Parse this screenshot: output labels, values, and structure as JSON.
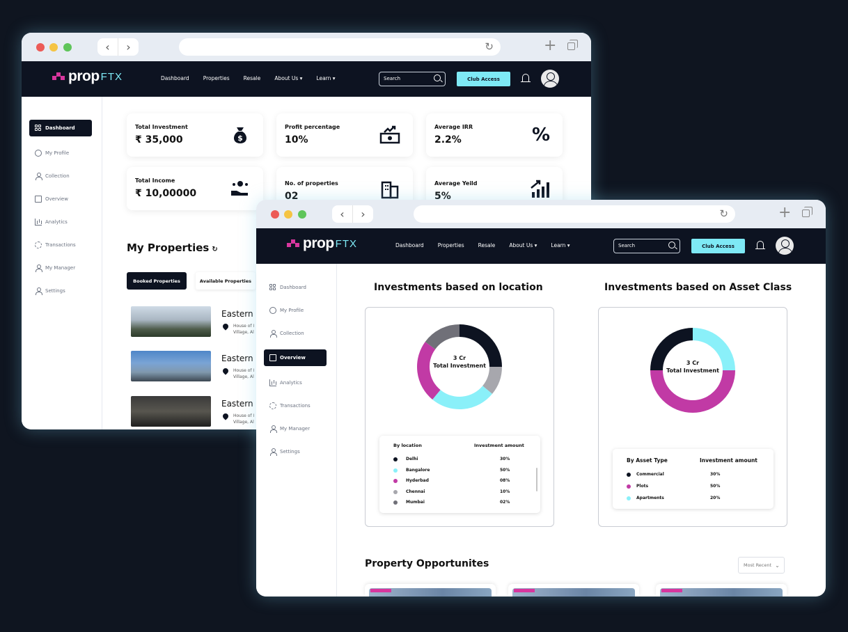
{
  "brand": {
    "word": "prop",
    "suffix": "FTX",
    "accent": "#d8369e",
    "secondary": "#7ee9f5",
    "dark": "#0d1321"
  },
  "nav": {
    "items": [
      "Dashboard",
      "Properties",
      "Resale",
      "About Us ▾",
      "Learn ▾"
    ],
    "search_placeholder": "Search",
    "club_button": "Club Access"
  },
  "sidebar": {
    "items": [
      {
        "label": "Dashboard",
        "icon": "grid-icon"
      },
      {
        "label": "My Profile",
        "icon": "profile-icon"
      },
      {
        "label": "Collection",
        "icon": "users-icon"
      },
      {
        "label": "Overview",
        "icon": "building-icon"
      },
      {
        "label": "Analytics",
        "icon": "bar-chart-icon"
      },
      {
        "label": "Transactions",
        "icon": "sync-icon"
      },
      {
        "label": "My Manager",
        "icon": "user-icon"
      },
      {
        "label": "Settings",
        "icon": "settings-icon"
      }
    ]
  },
  "back": {
    "stats": [
      {
        "label": "Total Investment",
        "value": "₹ 35,000",
        "icon": "money-bag-icon"
      },
      {
        "label": "Profit percentage",
        "value": "10%",
        "icon": "cash-growth-icon"
      },
      {
        "label": "Average IRR",
        "value": "2.2%",
        "icon": "percent-icon"
      },
      {
        "label": "Total Income",
        "value": "₹ 10,00000",
        "icon": "hand-coins-icon"
      },
      {
        "label": "No. of properties",
        "value": "02",
        "icon": "buildings-icon"
      },
      {
        "label": "Average Yeild",
        "value": "5%",
        "icon": "growth-chart-icon"
      }
    ],
    "my_properties": "My Properties",
    "tabs": [
      "Booked Properties",
      "Available Properties"
    ],
    "properties": [
      {
        "name": "Eastern C",
        "addr1": "House of I",
        "addr2": "Village, Al"
      },
      {
        "name": "Eastern C",
        "addr1": "House of I",
        "addr2": "Village, Al"
      },
      {
        "name": "Eastern C",
        "addr1": "House of I",
        "addr2": "Village, Al"
      }
    ]
  },
  "front": {
    "location_title": "Investments based on location",
    "asset_title": "Investments based on Asset Class",
    "center_amount": "3 Cr",
    "center_label": "Total Investment",
    "location_legend": {
      "col1": "By location",
      "col2": "Investment amount",
      "rows": [
        {
          "name": "Delhi",
          "value": "30%",
          "color": "#0d1321"
        },
        {
          "name": "Bangalore",
          "value": "50%",
          "color": "#8af0f9"
        },
        {
          "name": "Hyderbad",
          "value": "08%",
          "color": "#c13aa5"
        },
        {
          "name": "Chennai",
          "value": "10%",
          "color": "#a7a7ad"
        },
        {
          "name": "Mumbai",
          "value": "02%",
          "color": "#707078"
        }
      ]
    },
    "asset_legend": {
      "col1": "By Asset Type",
      "col2": "Investment amount",
      "rows": [
        {
          "name": "Commercial",
          "value": "30%",
          "color": "#0d1321"
        },
        {
          "name": "Plots",
          "value": "50%",
          "color": "#c13aa5"
        },
        {
          "name": "Apartments",
          "value": "20%",
          "color": "#8af0f9"
        }
      ]
    },
    "opportunities_title": "Property Opportunites",
    "sort_label": "Most Recent"
  },
  "chart_data": [
    {
      "type": "pie",
      "title": "Investments based on location",
      "center_text": "3 Cr Total Investment",
      "slices": [
        {
          "name": "Delhi",
          "value": 25,
          "color": "#0d1321"
        },
        {
          "name": "Chennai",
          "value": 11,
          "color": "#a7a7ad"
        },
        {
          "name": "Bangalore",
          "value": 25,
          "color": "#8af0f9"
        },
        {
          "name": "Hyderbad",
          "value": 24,
          "color": "#c13aa5"
        },
        {
          "name": "Mumbai",
          "value": 15,
          "color": "#707078"
        }
      ]
    },
    {
      "type": "pie",
      "title": "Investments based on Asset Class",
      "center_text": "3 Cr Total Investment",
      "slices": [
        {
          "name": "Apartments",
          "value": 25,
          "color": "#8af0f9"
        },
        {
          "name": "Plots",
          "value": 50,
          "color": "#c13aa5"
        },
        {
          "name": "Commercial",
          "value": 25,
          "color": "#0d1321"
        }
      ]
    }
  ]
}
